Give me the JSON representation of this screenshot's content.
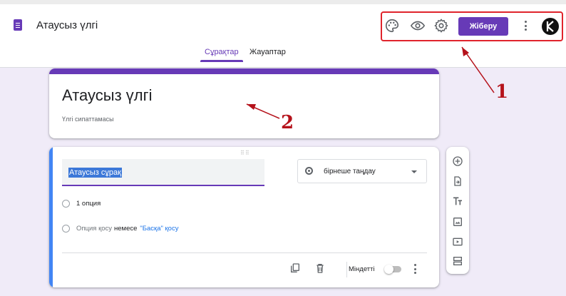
{
  "app": {
    "title": "Атаусыз үлгі"
  },
  "header": {
    "icons": [
      "palette-icon",
      "eye-icon",
      "gear-icon",
      "more-vert-icon"
    ],
    "send_label": "Жіберу",
    "tabs": [
      {
        "label": "Сұрақтар",
        "active": true
      },
      {
        "label": "Жауаптар",
        "active": false
      }
    ]
  },
  "form": {
    "title": "Атаусыз үлгі",
    "description": "Үлгі сипаттамасы"
  },
  "question": {
    "text": "Атаусыз сұрақ",
    "type": "бірнеше таңдау",
    "options": [
      "1 опция"
    ],
    "add_option": "Опция қосу",
    "or": "немесе",
    "add_other": "\"Басқа\" қосу",
    "required_label": "Міндетті",
    "required": false
  },
  "toolbar": {
    "icons": [
      "add-question-icon",
      "import-questions-icon",
      "add-title-icon",
      "add-image-icon",
      "add-video-icon",
      "add-section-icon"
    ]
  },
  "annotations": {
    "label_1": "1",
    "label_2": "2"
  },
  "colors": {
    "accent": "#673ab7",
    "background": "#f0ebf8",
    "annotation_red": "#e0242c",
    "question_accent": "#4285f4"
  }
}
